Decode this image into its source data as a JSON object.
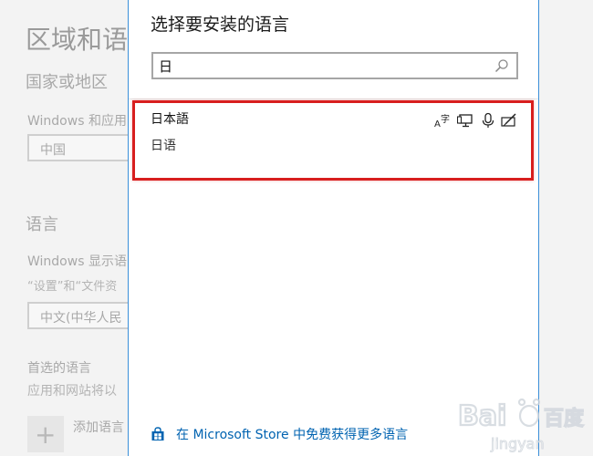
{
  "background_page": {
    "title": "区域和语",
    "country_heading": "国家或地区",
    "windows_apps_label": "Windows 和应用",
    "country_value": "中国",
    "language_heading": "语言",
    "display_language_label": "Windows 显示语",
    "settings_note": "“设置”和“文件资",
    "display_language_value": "中文(中华人民",
    "preferred_heading": "首选的语言",
    "apps_sites_note": "应用和网站将以",
    "add_language_label": "添加语言"
  },
  "dialog": {
    "title": "选择要安装的语言",
    "search": {
      "value": "日"
    },
    "results": [
      {
        "native_name": "日本語",
        "localized_name": "日语",
        "features": [
          "text-to-speech-icon",
          "display-language-icon",
          "speech-recognition-icon",
          "handwriting-icon"
        ]
      }
    ],
    "store_link": "在 Microsoft Store 中免费获得更多语言"
  },
  "colors": {
    "highlight": "#d81e1e",
    "link": "#0063b1",
    "dialog_border": "#3b8fd9"
  }
}
